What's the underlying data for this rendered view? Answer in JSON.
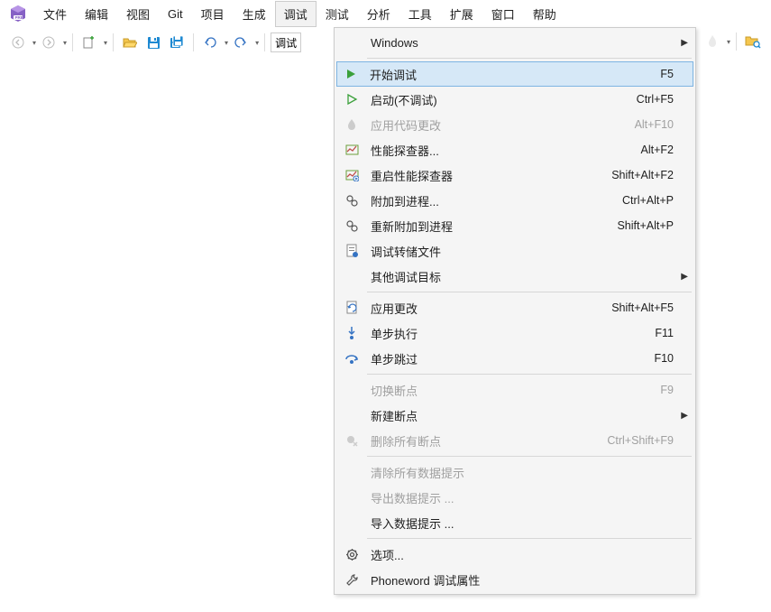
{
  "menubar": {
    "items": [
      "文件",
      "编辑",
      "视图",
      "Git",
      "项目",
      "生成",
      "调试",
      "测试",
      "分析",
      "工具",
      "扩展",
      "窗口",
      "帮助"
    ],
    "activeIndex": 6
  },
  "toolbar": {
    "combo1": "调试"
  },
  "dropdown": {
    "items": [
      {
        "type": "item",
        "label": "Windows",
        "shortcut": "",
        "icon": "",
        "submenu": true
      },
      {
        "type": "sep"
      },
      {
        "type": "item",
        "label": "开始调试",
        "shortcut": "F5",
        "icon": "play-green",
        "highlighted": true
      },
      {
        "type": "item",
        "label": "启动(不调试)",
        "shortcut": "Ctrl+F5",
        "icon": "play-outline"
      },
      {
        "type": "item",
        "label": "应用代码更改",
        "shortcut": "Alt+F10",
        "icon": "flame",
        "disabled": true
      },
      {
        "type": "item",
        "label": "性能探查器...",
        "shortcut": "Alt+F2",
        "icon": "perf"
      },
      {
        "type": "item",
        "label": "重启性能探查器",
        "shortcut": "Shift+Alt+F2",
        "icon": "perf-restart"
      },
      {
        "type": "item",
        "label": "附加到进程...",
        "shortcut": "Ctrl+Alt+P",
        "icon": "attach"
      },
      {
        "type": "item",
        "label": "重新附加到进程",
        "shortcut": "Shift+Alt+P",
        "icon": "attach"
      },
      {
        "type": "item",
        "label": "调试转储文件",
        "shortcut": "",
        "icon": "dump"
      },
      {
        "type": "item",
        "label": "其他调试目标",
        "shortcut": "",
        "icon": "",
        "submenu": true
      },
      {
        "type": "sep"
      },
      {
        "type": "item",
        "label": "应用更改",
        "shortcut": "Shift+Alt+F5",
        "icon": "apply"
      },
      {
        "type": "item",
        "label": "单步执行",
        "shortcut": "F11",
        "icon": "step-into"
      },
      {
        "type": "item",
        "label": "单步跳过",
        "shortcut": "F10",
        "icon": "step-over"
      },
      {
        "type": "sep"
      },
      {
        "type": "item",
        "label": "切换断点",
        "shortcut": "F9",
        "icon": "",
        "disabled": true
      },
      {
        "type": "item",
        "label": "新建断点",
        "shortcut": "",
        "icon": "",
        "submenu": true
      },
      {
        "type": "item",
        "label": "删除所有断点",
        "shortcut": "Ctrl+Shift+F9",
        "icon": "delete-bp",
        "disabled": true
      },
      {
        "type": "sep"
      },
      {
        "type": "item",
        "label": "清除所有数据提示",
        "shortcut": "",
        "icon": "",
        "disabled": true
      },
      {
        "type": "item",
        "label": "导出数据提示 ...",
        "shortcut": "",
        "icon": "",
        "disabled": true
      },
      {
        "type": "item",
        "label": "导入数据提示 ...",
        "shortcut": "",
        "icon": ""
      },
      {
        "type": "sep"
      },
      {
        "type": "item",
        "label": "选项...",
        "shortcut": "",
        "icon": "gear"
      },
      {
        "type": "item",
        "label": "Phoneword 调试属性",
        "shortcut": "",
        "icon": "wrench"
      }
    ]
  }
}
